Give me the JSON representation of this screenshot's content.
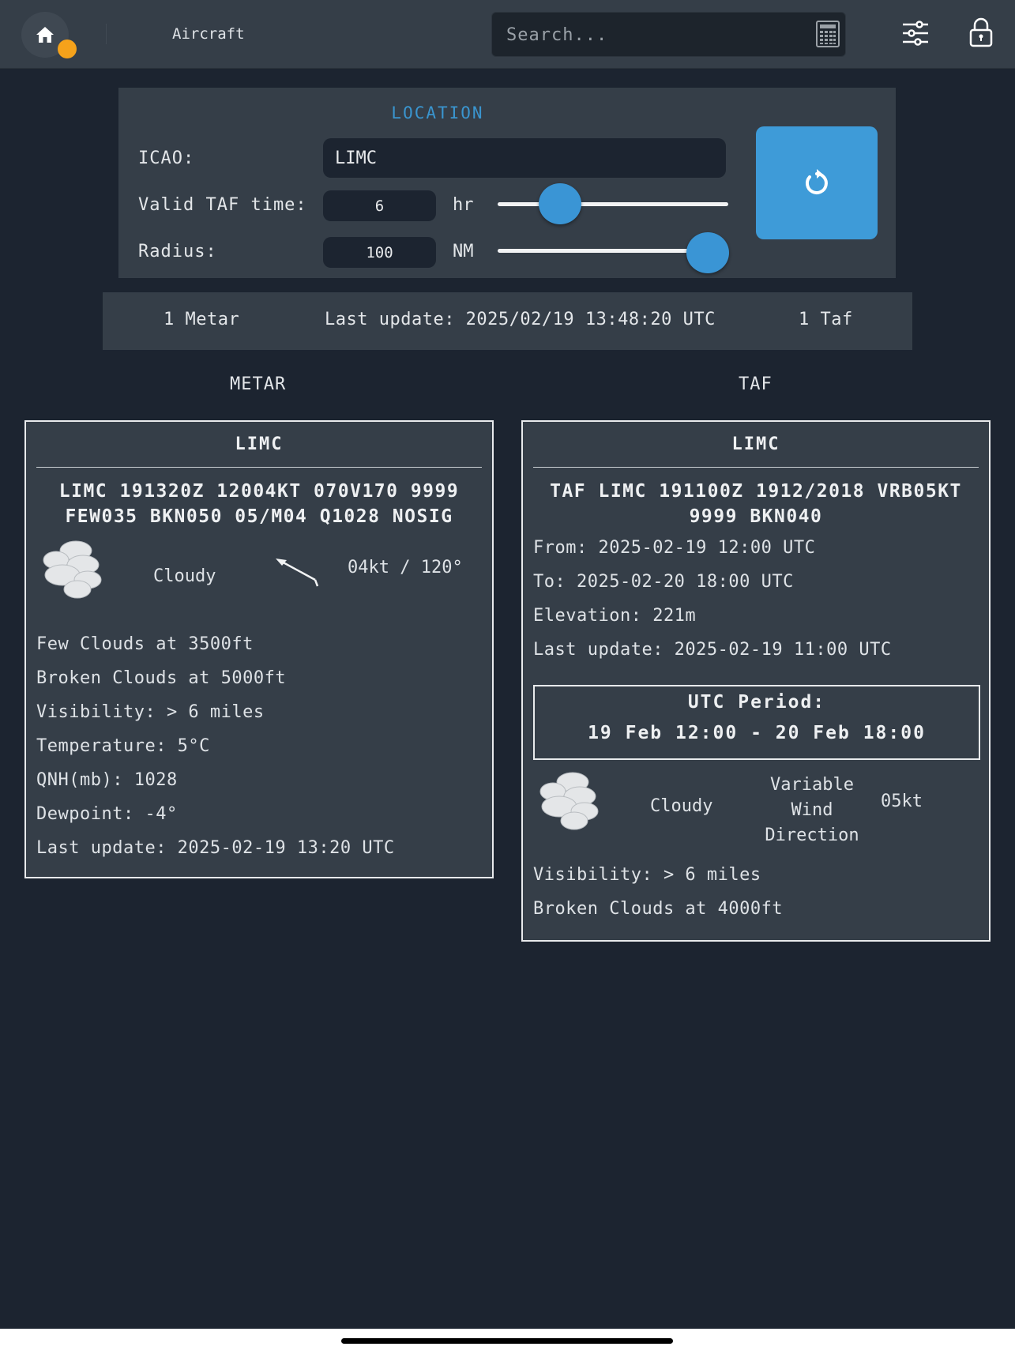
{
  "topbar": {
    "title": "Aircraft",
    "search_placeholder": "Search...",
    "icons": [
      "home-icon",
      "notification-dot",
      "calculator-icon",
      "sliders-icon",
      "lock-icon"
    ],
    "status_dot_color": "#f5a21b"
  },
  "location": {
    "title": "LOCATION",
    "icao_label": "ICAO:",
    "icao_value": "LIMC",
    "taf_label": "Valid TAF time:",
    "taf_value": "6",
    "taf_unit": "hr",
    "taf_slider_fraction": 0.27,
    "radius_label": "Radius:",
    "radius_value": "100",
    "radius_unit": "NM",
    "radius_slider_fraction": 0.91,
    "refresh_icon": "refresh-icon",
    "accent_color": "#3a95d5"
  },
  "status": {
    "metar_count": "1 Metar",
    "last_update": "Last update: 2025/02/19 13:48:20 UTC",
    "taf_count": "1 Taf"
  },
  "columns": {
    "metar": "METAR",
    "taf": "TAF"
  },
  "metar": {
    "station": "LIMC",
    "raw": "LIMC 191320Z 12004KT 070V170 9999 FEW035 BKN050 05/M04 Q1028 NOSIG",
    "sky": "Cloudy",
    "sky_icon": "cloud-icon",
    "wind_icon": "wind-arrow-icon",
    "wind": "04kt / 120°",
    "lines": [
      "Few Clouds at 3500ft",
      "Broken Clouds at 5000ft",
      "Visibility: > 6 miles",
      "Temperature: 5°C",
      "QNH(mb): 1028",
      "Dewpoint: -4°",
      "Last update: 2025-02-19 13:20 UTC"
    ]
  },
  "taf": {
    "station": "LIMC",
    "raw": "TAF LIMC 191100Z 1912/2018 VRB05KT 9999 BKN040",
    "lines": [
      "From: 2025-02-19 12:00 UTC",
      "To: 2025-02-20 18:00 UTC",
      "Elevation: 221m",
      "Last update: 2025-02-19 11:00 UTC"
    ],
    "period_title": "UTC Period:",
    "period": "19 Feb 12:00 - 20 Feb 18:00",
    "sky": "Cloudy",
    "sky_icon": "cloud-icon",
    "wind_dir_lines": [
      "Variable",
      "Wind",
      "Direction"
    ],
    "wind_speed": "05kt",
    "bottom_lines": [
      "Visibility: > 6 miles",
      "Broken Clouds at 4000ft"
    ]
  }
}
